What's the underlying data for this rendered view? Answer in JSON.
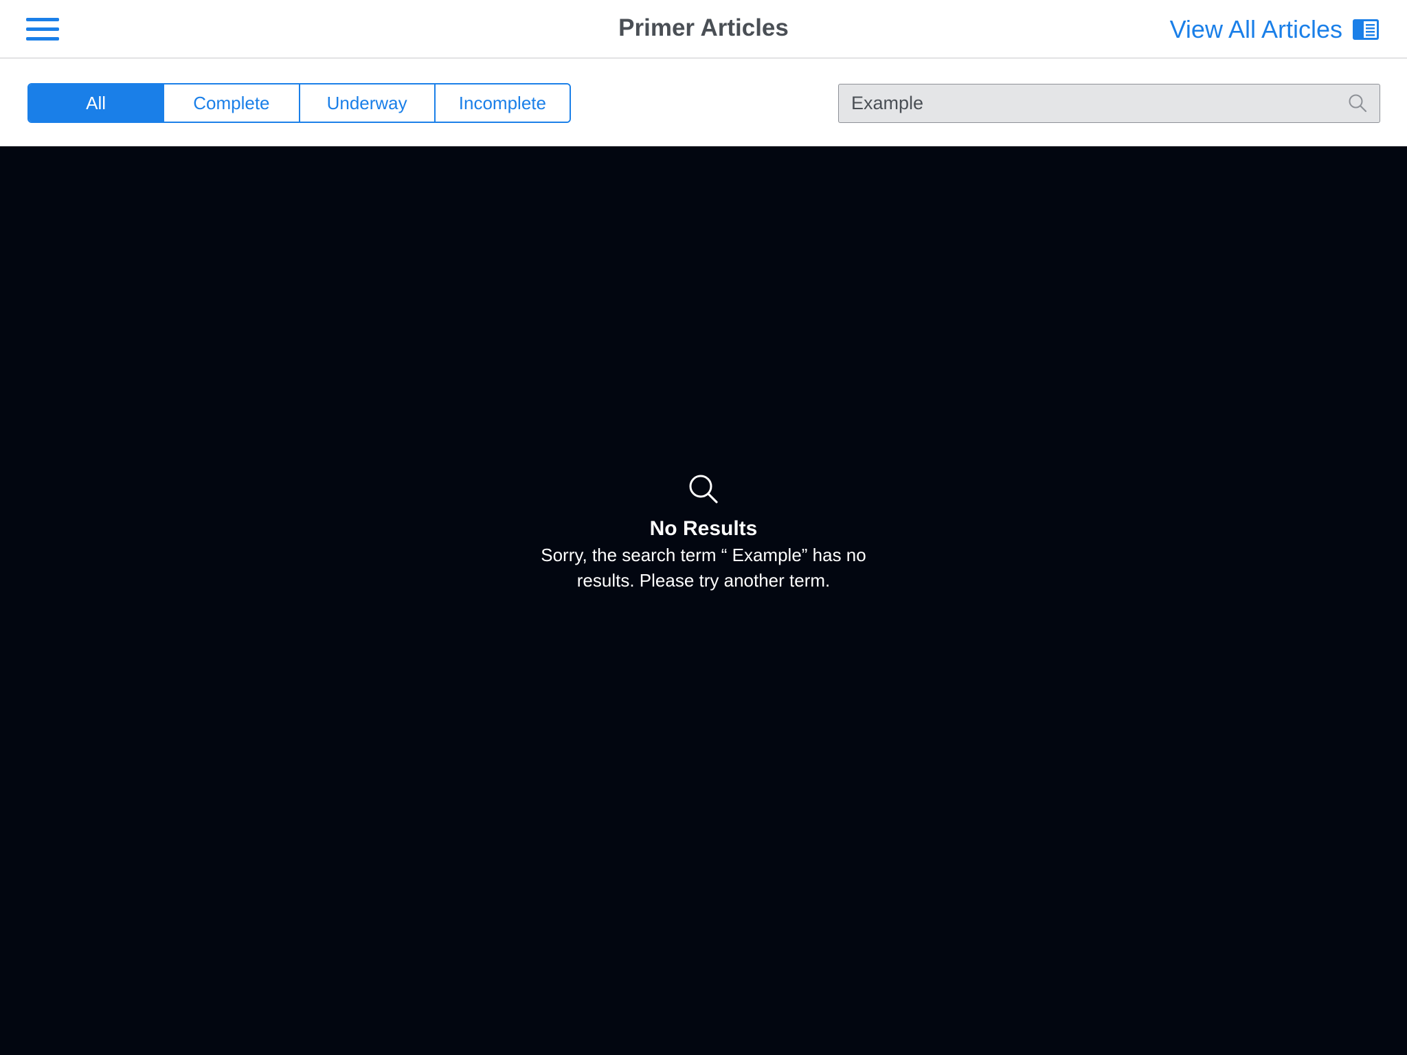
{
  "header": {
    "title": "Primer Articles",
    "view_all_label": "View All Articles",
    "menu_icon": "hamburger-menu-icon",
    "view_all_icon": "article-list-icon"
  },
  "filters": {
    "tabs": [
      {
        "label": "All",
        "selected": true
      },
      {
        "label": "Complete",
        "selected": false
      },
      {
        "label": "Underway",
        "selected": false
      },
      {
        "label": "Incomplete",
        "selected": false
      }
    ]
  },
  "search": {
    "value": "Example",
    "icon": "search-icon"
  },
  "empty_state": {
    "icon": "search-icon",
    "title": "No Results",
    "message": "Sorry, the search term “ Example” has no results. Please try another term."
  },
  "colors": {
    "accent": "#1a7fe8",
    "title_text": "#4a4f55",
    "content_background": "#020610",
    "search_background": "#e4e5e7"
  }
}
